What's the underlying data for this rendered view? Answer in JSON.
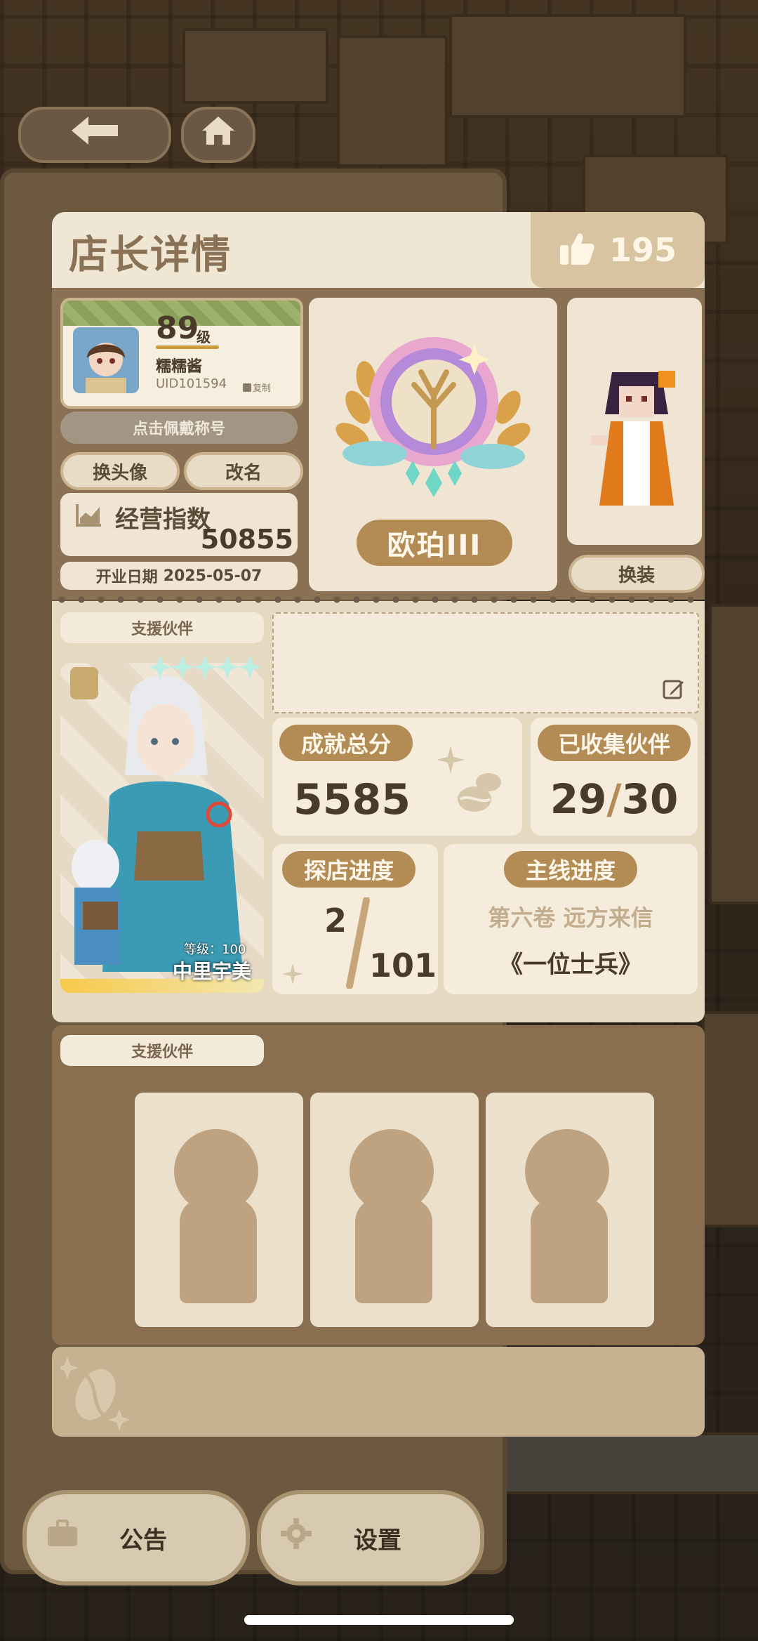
{
  "header": {
    "title": "店长详情",
    "likes": "195"
  },
  "profile": {
    "level": "89",
    "level_unit": "级",
    "name": "糯糯酱",
    "uid": "UID101594",
    "copy_label": "复制",
    "title_button": "点击佩戴称号",
    "change_avatar": "换头像",
    "rename": "改名",
    "business_index_label": "经营指数",
    "business_index_value": "50855",
    "open_date_label": "开业日期",
    "open_date": "2025-05-07"
  },
  "rank": {
    "label": "欧珀III"
  },
  "outfit": {
    "change_button": "换装"
  },
  "support_partner": {
    "label": "支援伙伴",
    "level_label": "等级：100",
    "name": "中里宇美",
    "stars": 5
  },
  "stats": {
    "achievement_label": "成就总分",
    "achievement_value": "5585",
    "collected_label": "已收集伙伴",
    "collected_count": "29",
    "collected_sep": "/",
    "collected_total": "30",
    "explore_label": "探店进度",
    "explore_current": "2",
    "explore_total": "101",
    "story_label": "主线进度",
    "story_volume": "第六卷 远方来信",
    "story_chapter": "《一位士兵》"
  },
  "support_slots": {
    "label": "支援伙伴",
    "count": 3
  },
  "bottom": {
    "notice": "公告",
    "settings": "设置"
  },
  "colors": {
    "accent": "#b38b55",
    "panel": "#efe5d2",
    "dark_panel": "#8a6e50"
  }
}
